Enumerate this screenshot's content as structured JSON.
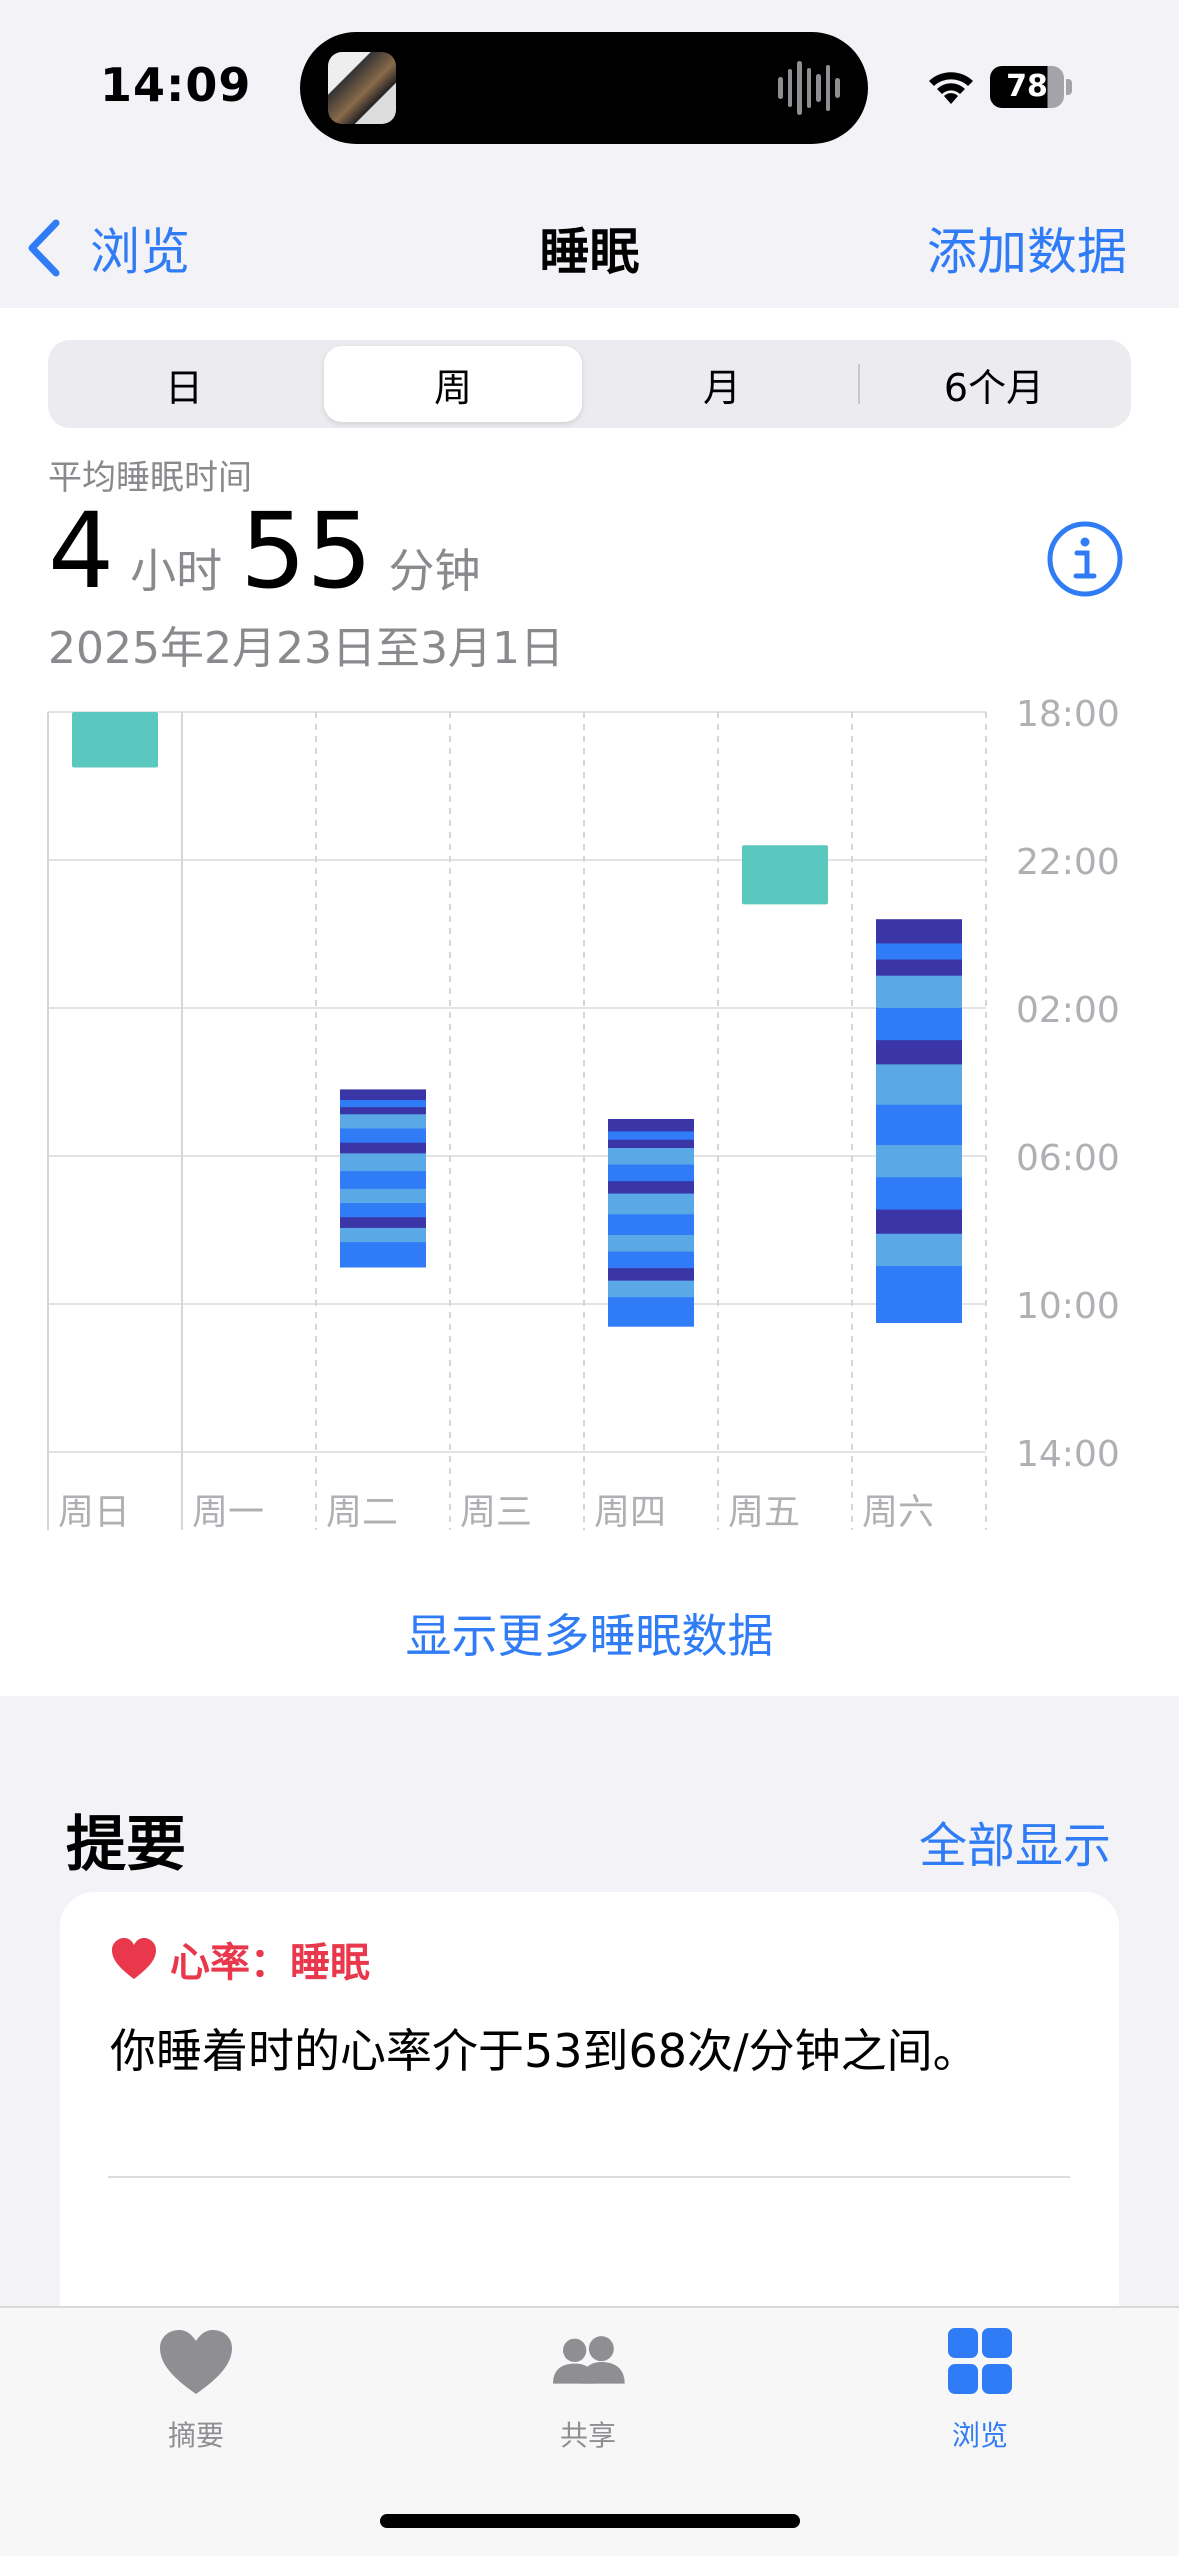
{
  "status": {
    "time": "14:09",
    "battery": "78"
  },
  "nav": {
    "back": "浏览",
    "title": "睡眠",
    "add": "添加数据"
  },
  "segments": [
    "日",
    "周",
    "月",
    "6个月"
  ],
  "active_segment": "周",
  "average": {
    "label": "平均睡眠时间",
    "hours": "4",
    "hours_unit": "小时",
    "minutes": "55",
    "minutes_unit": "分钟",
    "date_range": "2025年2月23日至3月1日"
  },
  "colors": {
    "accent": "#2f7cf6",
    "awake": "#5bc8c0",
    "rem": "#5aa9e6",
    "core": "#2f7cf6",
    "deep": "#3a36a8",
    "heart": "#e9374b"
  },
  "chart_data": {
    "type": "range-bar",
    "categories": [
      "周日",
      "周一",
      "周二",
      "周三",
      "周四",
      "周五",
      "周六"
    ],
    "y_ticks": [
      "18:00",
      "22:00",
      "02:00",
      "06:00",
      "10:00",
      "14:00"
    ],
    "y_range_hours": [
      18,
      38
    ],
    "series": [
      {
        "day": "周日",
        "start": 18.0,
        "end": 19.5,
        "stage": "awake"
      },
      {
        "day": "周二",
        "start": 28.2,
        "end": 33.0,
        "stage": "asleep"
      },
      {
        "day": "周四",
        "start": 29.0,
        "end": 34.6,
        "stage": "asleep"
      },
      {
        "day": "周五",
        "start": 21.6,
        "end": 23.2,
        "stage": "awake"
      },
      {
        "day": "周六",
        "start": 23.6,
        "end": 34.5,
        "stage": "asleep"
      }
    ]
  },
  "show_more": "显示更多睡眠数据",
  "summary": {
    "title": "提要",
    "show_all": "全部显示",
    "card_title": "心率：睡眠",
    "card_text": "你睡着时的心率介于53到68次/分钟之间。"
  },
  "tabs": [
    {
      "label": "摘要",
      "icon": "heart-icon"
    },
    {
      "label": "共享",
      "icon": "people-icon"
    },
    {
      "label": "浏览",
      "icon": "grid-icon"
    }
  ]
}
